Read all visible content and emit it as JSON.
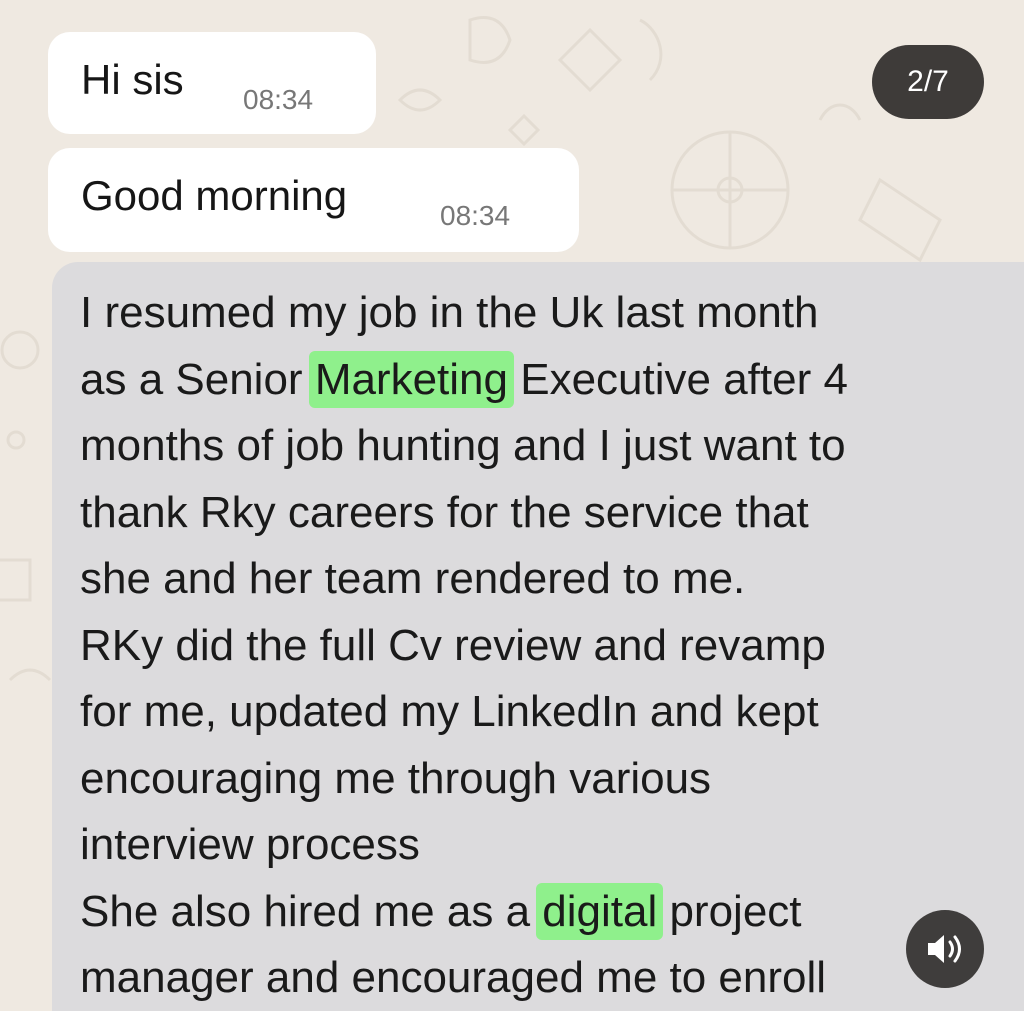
{
  "story": {
    "counter": "2/7",
    "sound_icon": "speaker-icon"
  },
  "messages": [
    {
      "text": "Hi sis",
      "time": "08:34"
    },
    {
      "text": "Good morning",
      "time": "08:34"
    }
  ],
  "long_message": {
    "lines": [
      [
        "I resumed my job in the Uk last month"
      ],
      [
        "as a Senior ",
        "Marketing",
        " Executive after 4"
      ],
      [
        "months of job hunting and I just want to"
      ],
      [
        "thank Rky careers for the service that"
      ],
      [
        "she and her team rendered to me."
      ],
      [
        "RKy did the full Cv review and revamp"
      ],
      [
        "for me, updated my LinkedIn and kept"
      ],
      [
        "encouraging me through various"
      ],
      [
        "interview process"
      ],
      [
        "She also hired me as a ",
        "digital",
        " project"
      ],
      [
        "manager and encouraged me to enroll"
      ]
    ],
    "highlight_color": "#8ff08c"
  },
  "colors": {
    "background": "#efe9e1",
    "bubble": "#ffffff",
    "selected_bubble": "#dcdbdd",
    "pill": "#3e3b39"
  }
}
